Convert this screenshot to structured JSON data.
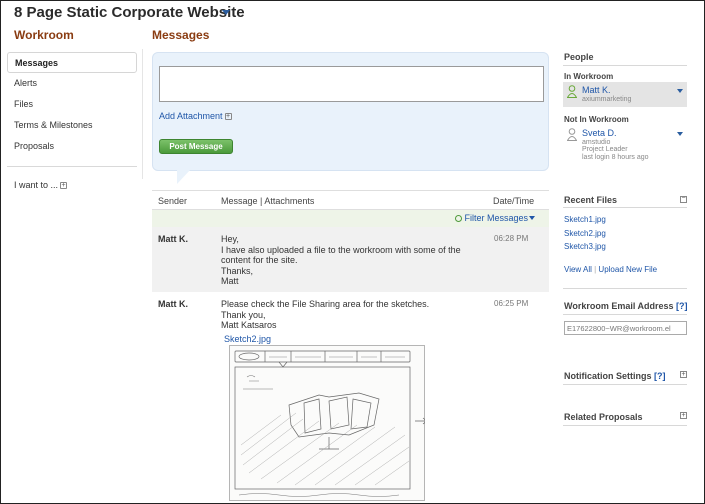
{
  "header": {
    "project_title": "8 Page Static Corporate Website"
  },
  "sidebar": {
    "heading": "Workroom",
    "items": [
      {
        "label": "Messages",
        "active": true
      },
      {
        "label": "Alerts"
      },
      {
        "label": "Files"
      },
      {
        "label": "Terms & Milestones"
      },
      {
        "label": "Proposals"
      }
    ],
    "i_want_to": "I want to ..."
  },
  "main": {
    "heading": "Messages",
    "compose": {
      "textarea_value": "",
      "add_attachment": "Add Attachment",
      "post_button": "Post Message"
    },
    "table": {
      "columns": [
        "Sender",
        "Message | Attachments",
        "Date/Time"
      ],
      "filter_label": "Filter Messages",
      "rows": [
        {
          "sender": "Matt K.",
          "lines": [
            "Hey,",
            "I have also uploaded a file to the workroom with some of the",
            "content for the site.",
            "Thanks,",
            "Matt"
          ],
          "time": "06:28 PM"
        },
        {
          "sender": "Matt K.",
          "lines": [
            "Please check the File Sharing area for the sketches.",
            "Thank you,",
            "Matt Katsaros"
          ],
          "time": "06:25 PM",
          "attachment": "Sketch2.jpg"
        }
      ]
    }
  },
  "right": {
    "people_heading": "People",
    "in_workroom_label": "In Workroom",
    "in_workroom": {
      "name": "Matt K.",
      "org": "axiummarketing"
    },
    "not_in_workroom_label": "Not In Workroom",
    "not_in_workroom": {
      "name": "Sveta D.",
      "org": "amstudio",
      "role": "Project Leader",
      "last_login": "last login 8 hours ago"
    },
    "recent_files_heading": "Recent Files",
    "recent_files": [
      "Sketch1.jpg",
      "Sketch2.jpg",
      "Sketch3.jpg"
    ],
    "view_all": "View All",
    "upload_new": "Upload New File",
    "email_heading": "Workroom Email Address",
    "help_mark": "[?]",
    "email_value": "E17622800~WR@workroom.el",
    "notification_heading": "Notification Settings",
    "related_heading": "Related Proposals"
  },
  "colors": {
    "heading_brown": "#8a3c12",
    "link_blue": "#1f56a8",
    "post_green": "#5aa948",
    "compose_bg": "#e9f2fb"
  }
}
